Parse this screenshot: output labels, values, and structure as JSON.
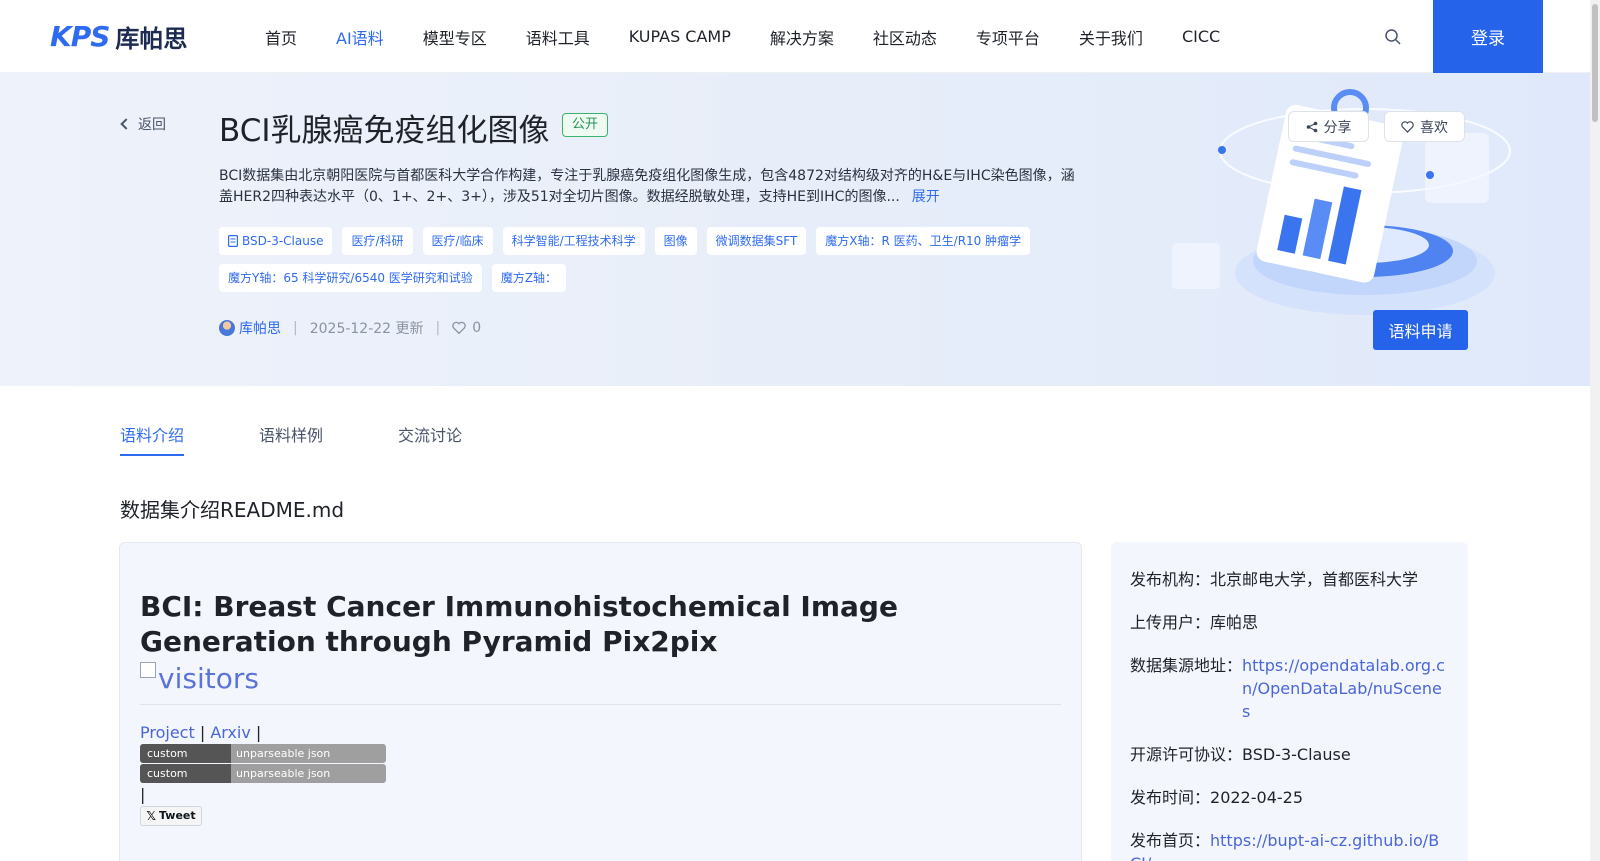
{
  "header": {
    "logo_mark": "KPS",
    "logo_text": "库帕思",
    "nav": [
      "首页",
      "AI语料",
      "模型专区",
      "语料工具",
      "KUPAS CAMP",
      "解决方案",
      "社区动态",
      "专项平台",
      "关于我们",
      "CICC"
    ],
    "active_nav": "AI语料",
    "login": "登录"
  },
  "banner": {
    "back": "返回",
    "title": "BCI乳腺癌免疫组化图像",
    "public_badge": "公开",
    "share": "分享",
    "like": "喜欢",
    "description": "BCI数据集由北京朝阳医院与首都医科大学合作构建，专注于乳腺癌免疫组化图像生成，包含4872对结构级对齐的H&E与IHC染色图像，涵盖HER2四种表达水平（0、1+、2+、3+），涉及51对全切片图像。数据经脱敏处理，支持HE到IHC的图像...",
    "expand": "展开",
    "tags": [
      "BSD-3-Clause",
      "医疗/科研",
      "医疗/临床",
      "科学智能/工程技术科学",
      "图像",
      "微调数据集SFT",
      "魔方X轴：R 医药、卫生/R10 肿瘤学",
      "魔方Y轴：65 科学研究/6540 医学研究和试验",
      "魔方Z轴："
    ],
    "author": "库帕思",
    "updated": "2025-12-22 更新",
    "likes": "0",
    "apply": "语料申请"
  },
  "tabs": [
    "语料介绍",
    "语料样例",
    "交流讨论"
  ],
  "active_tab": "语料介绍",
  "section_title": "数据集介绍README.md",
  "readme": {
    "heading": "BCI: Breast Cancer Immunohistochemical Image Generation through Pyramid Pix2pix",
    "broken_image_alt": "visitors",
    "link_project": "Project",
    "link_arxiv": "Arxiv",
    "separator": "|",
    "badges": [
      {
        "label": "custom badge",
        "message": "unparseable json response"
      },
      {
        "label": "custom badge",
        "message": "unparseable json response"
      }
    ],
    "tweet": "Tweet"
  },
  "info": {
    "publisher_label": "发布机构：",
    "publisher": "北京邮电大学，首都医科大学",
    "uploader_label": "上传用户：",
    "uploader": "库帕思",
    "source_label": "数据集源地址：",
    "source": "https://opendatalab.org.cn/OpenDataLab/nuScenes",
    "license_label": "开源许可协议：",
    "license": "BSD-3-Clause",
    "date_label": "发布时间：",
    "date": "2022-04-25",
    "homepage_label": "发布首页：",
    "homepage": "https://bupt-ai-cz.github.io/BCI/"
  },
  "colors": {
    "accent": "#2f6bf0",
    "button": "#2563eb",
    "public_badge": "#249653"
  }
}
